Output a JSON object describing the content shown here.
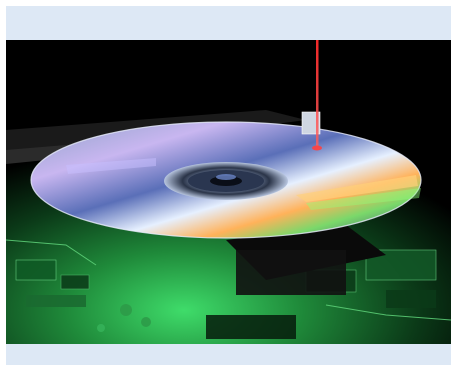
{
  "figure": {
    "alt": "",
    "colors": {
      "frame_background": "#dde8f5",
      "photo_background": "#000000",
      "laser": "#ff2a2a",
      "circuit_board": "#1f8a3a"
    }
  }
}
